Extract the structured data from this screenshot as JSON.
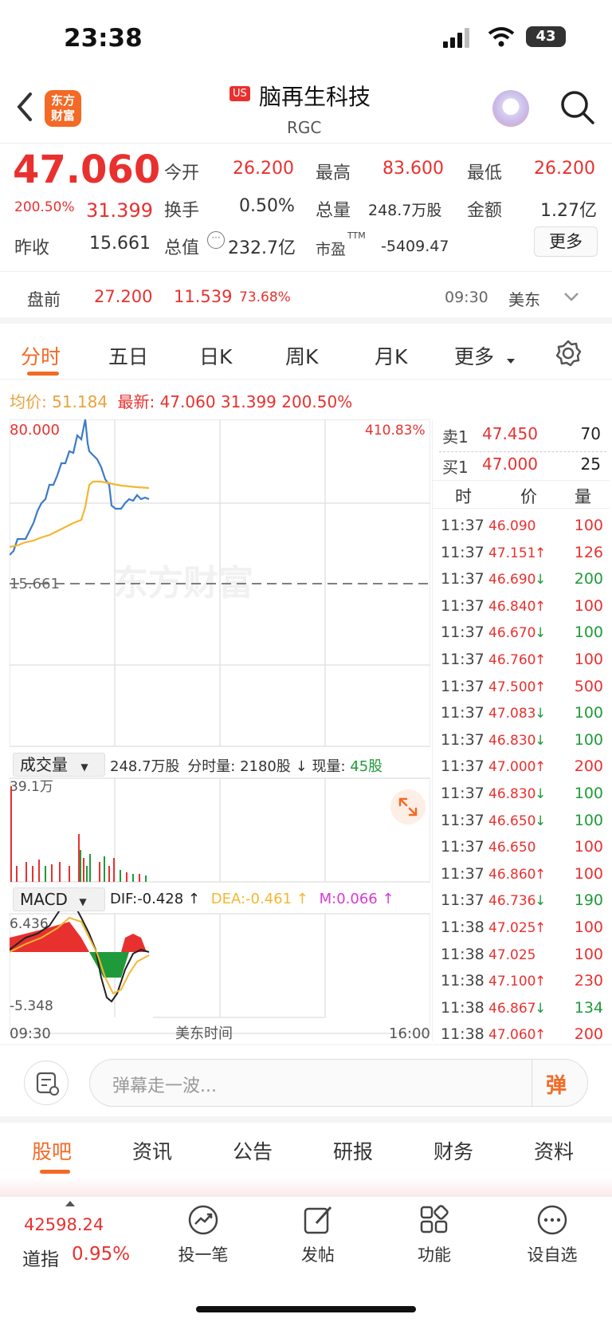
{
  "status": {
    "time": "23:38",
    "battery": "43"
  },
  "header": {
    "logo_text": "东方财富",
    "market": "US",
    "name": "脑再生科技",
    "code": "RGC"
  },
  "quote": {
    "price": "47.060",
    "change_pct": "200.50%",
    "change": "31.399",
    "open_label": "今开",
    "open": "26.200",
    "high_label": "最高",
    "high": "83.600",
    "low_label": "最低",
    "low": "26.200",
    "turnover_label": "换手",
    "turnover": "0.50%",
    "volume_label": "总量",
    "volume": "248.7万股",
    "amount_label": "金额",
    "amount": "1.27亿",
    "prev_close_label": "昨收",
    "prev_close": "15.661",
    "mktcap_label": "总值",
    "mktcap": "232.7亿",
    "pe_label": "市盈",
    "pe_sup": "TTM",
    "pe": "-5409.47",
    "more": "更多"
  },
  "premarket": {
    "label": "盘前",
    "price": "27.200",
    "change": "11.539",
    "change_pct": "73.68%",
    "time": "09:30",
    "zone": "美东"
  },
  "tabs": [
    "分时",
    "五日",
    "日K",
    "周K",
    "月K",
    "更多"
  ],
  "chart_info": {
    "avg_label": "均价:",
    "avg": "51.184",
    "latest_label": "最新:",
    "latest": "47.060",
    "chg": "31.399",
    "pct": "200.50%"
  },
  "main_chart": {
    "y_top": "80.000",
    "pct_top": "410.83%",
    "ref": "15.661",
    "watermark": "东方财富"
  },
  "volume_panel": {
    "selector": "成交量",
    "total": "248.7万股",
    "tick_label": "分时量:",
    "tick": "2180股",
    "now_label": "现量:",
    "now": "45股",
    "y_top": "39.1万"
  },
  "macd_panel": {
    "selector": "MACD",
    "dif": "DIF:-0.428 ↑",
    "dea": "DEA:-0.461 ↑",
    "m": "M:0.066 ↑",
    "y_top": "6.436",
    "y_bot": "-5.348"
  },
  "x_axis": {
    "start": "09:30",
    "mid": "美东时间",
    "end": "16:00"
  },
  "orderbook": {
    "sell_label": "卖1",
    "sell_price": "47.450",
    "sell_vol": "70",
    "buy_label": "买1",
    "buy_price": "47.000",
    "buy_vol": "25",
    "headers": [
      "时",
      "价",
      "量"
    ],
    "trades": [
      {
        "t": "11:37",
        "p": "46.090",
        "a": "",
        "v": "100"
      },
      {
        "t": "11:37",
        "p": "47.151",
        "a": "↑",
        "v": "126"
      },
      {
        "t": "11:37",
        "p": "46.690",
        "a": "↓",
        "v": "200"
      },
      {
        "t": "11:37",
        "p": "46.840",
        "a": "↑",
        "v": "100"
      },
      {
        "t": "11:37",
        "p": "46.670",
        "a": "↓",
        "v": "100"
      },
      {
        "t": "11:37",
        "p": "46.760",
        "a": "↑",
        "v": "100"
      },
      {
        "t": "11:37",
        "p": "47.500",
        "a": "↑",
        "v": "500"
      },
      {
        "t": "11:37",
        "p": "47.083",
        "a": "↓",
        "v": "100"
      },
      {
        "t": "11:37",
        "p": "46.830",
        "a": "↓",
        "v": "100"
      },
      {
        "t": "11:37",
        "p": "47.000",
        "a": "↑",
        "v": "200"
      },
      {
        "t": "11:37",
        "p": "46.830",
        "a": "↓",
        "v": "100"
      },
      {
        "t": "11:37",
        "p": "46.650",
        "a": "↓",
        "v": "100"
      },
      {
        "t": "11:37",
        "p": "46.650",
        "a": "",
        "v": "100"
      },
      {
        "t": "11:37",
        "p": "46.860",
        "a": "↑",
        "v": "100"
      },
      {
        "t": "11:37",
        "p": "46.736",
        "a": "↓",
        "v": "190"
      },
      {
        "t": "11:38",
        "p": "47.025",
        "a": "↑",
        "v": "100"
      },
      {
        "t": "11:38",
        "p": "47.025",
        "a": "",
        "v": "100"
      },
      {
        "t": "11:38",
        "p": "47.100",
        "a": "↑",
        "v": "230"
      },
      {
        "t": "11:38",
        "p": "46.867",
        "a": "↓",
        "v": "134"
      },
      {
        "t": "11:38",
        "p": "47.060",
        "a": "↑",
        "v": "200"
      }
    ]
  },
  "comment": {
    "placeholder": "弹幕走一波...",
    "danmu": "弹"
  },
  "section_tabs": [
    "股吧",
    "资讯",
    "公告",
    "研报",
    "财务",
    "资料"
  ],
  "bottom": {
    "index_value": "42598.24",
    "index_name": "道指",
    "index_pct": "0.95%",
    "actions": [
      "投一笔",
      "发帖",
      "功能",
      "设自选"
    ]
  }
}
